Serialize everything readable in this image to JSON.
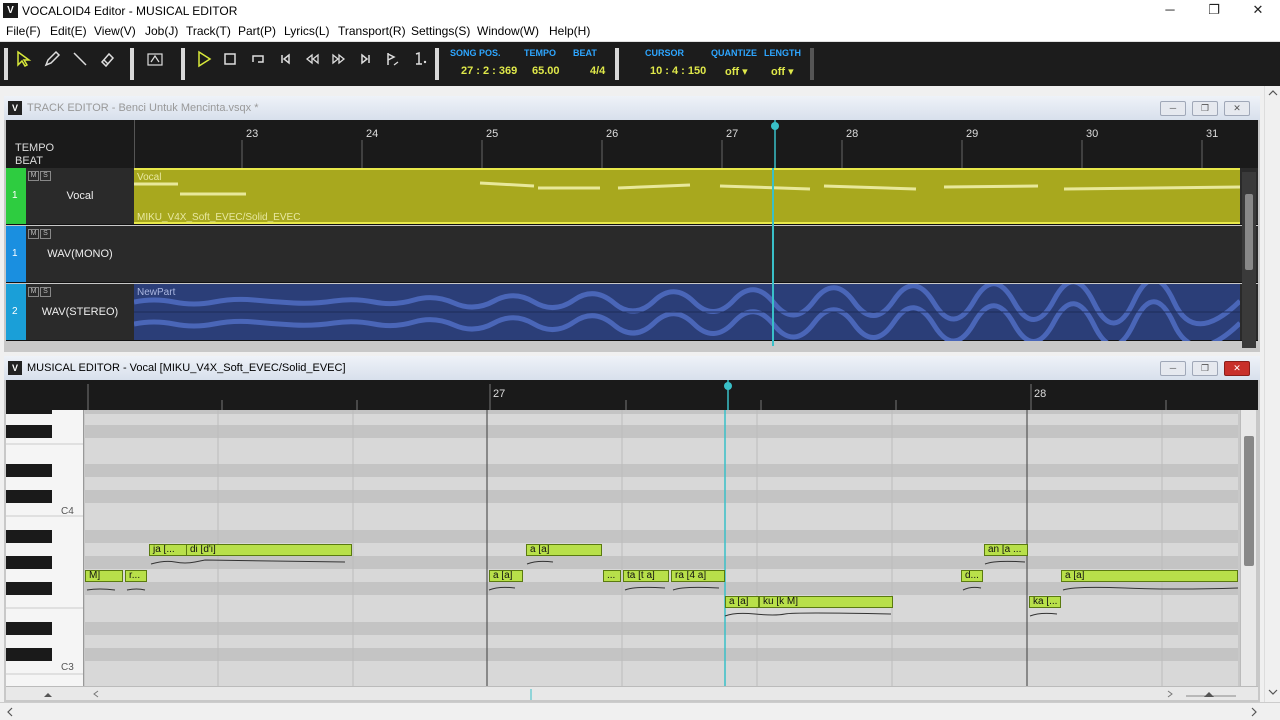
{
  "window": {
    "title": "VOCALOID4 Editor - MUSICAL EDITOR",
    "app_icon": "V",
    "minimize_glyph": "─",
    "restore_glyph": "❐",
    "close_glyph": "✕"
  },
  "menu": [
    "File(F)",
    "Edit(E)",
    "View(V)",
    "Job(J)",
    "Track(T)",
    "Part(P)",
    "Lyrics(L)",
    "Transport(R)",
    "Settings(S)",
    "Window(W)",
    "Help(H)"
  ],
  "toolbar": {
    "song_pos_label": "SONG POS.",
    "song_pos": "27 : 2 : 369",
    "tempo_label": "TEMPO",
    "tempo": "65.00",
    "beat_label": "BEAT",
    "beat": "4/4",
    "cursor_label": "CURSOR",
    "cursor": "10 : 4 : 150",
    "quantize_label": "QUANTIZE",
    "quantize": "off ▾",
    "length_label": "LENGTH",
    "length": "off ▾"
  },
  "track_editor": {
    "title": "TRACK EDITOR - Benci Untuk Mencinta.vsqx *",
    "tempo_label": "TEMPO",
    "beat_label": "BEAT",
    "bars": [
      "23",
      "24",
      "25",
      "26",
      "27",
      "28",
      "29",
      "30",
      "31"
    ],
    "tracks": [
      {
        "num": "1",
        "name": "Vocal",
        "color": "#2ecc40",
        "part_name": "Vocal",
        "part_singer": "MIKU_V4X_Soft_EVEC/Solid_EVEC"
      },
      {
        "num": "1",
        "name": "WAV(MONO)",
        "color": "#1a8fe0"
      },
      {
        "num": "2",
        "name": "WAV(STEREO)",
        "color": "#1a9fd8",
        "part_name": "NewPart"
      }
    ],
    "mute_label": "M",
    "solo_label": "S"
  },
  "musical_editor": {
    "title": "MUSICAL EDITOR - Vocal [MIKU_V4X_Soft_EVEC/Solid_EVEC]",
    "bars": [
      "27",
      "28"
    ],
    "key_c4": "C4",
    "key_c3": "C3",
    "notes": [
      {
        "text": "ja [..."
      },
      {
        "text": "di [d'i]"
      },
      {
        "text": "M]"
      },
      {
        "text": "r..."
      },
      {
        "text": "a [a]"
      },
      {
        "text": "a [a]"
      },
      {
        "text": "..."
      },
      {
        "text": "ta [t a]"
      },
      {
        "text": "ra [4 a]"
      },
      {
        "text": "a [a]"
      },
      {
        "text": "ku [k M]"
      },
      {
        "text": "an [a ..."
      },
      {
        "text": "d..."
      },
      {
        "text": "a [a]"
      },
      {
        "text": "ka [..."
      }
    ]
  },
  "colors": {
    "vocal_part": "#a8a81e",
    "wave_part": "#2b3e78",
    "playhead": "#39c0c8",
    "note": "#b8e04a"
  }
}
